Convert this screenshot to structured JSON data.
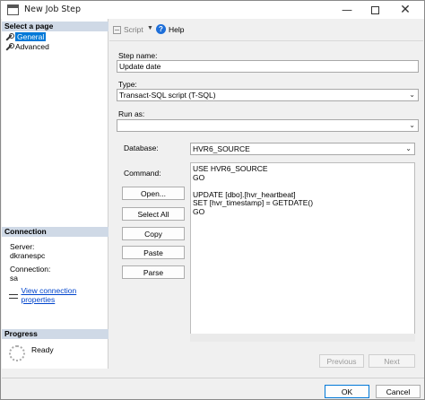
{
  "window": {
    "title": "New Job Step"
  },
  "sidebar": {
    "select_page_header": "Select a page",
    "pages": [
      {
        "label": "General",
        "selected": true
      },
      {
        "label": "Advanced",
        "selected": false
      }
    ],
    "connection_header": "Connection",
    "server_label": "Server:",
    "server_value": "dkranespc",
    "connection_label": "Connection:",
    "connection_value": "sa",
    "view_connection_link": "View connection properties",
    "progress_header": "Progress",
    "progress_status": "Ready"
  },
  "toolbar": {
    "script_label": "Script",
    "help_label": "Help"
  },
  "form": {
    "step_name_label": "Step name:",
    "step_name_value": "Update date",
    "type_label": "Type:",
    "type_value": "Transact-SQL script (T-SQL)",
    "run_as_label": "Run as:",
    "run_as_value": "",
    "database_label": "Database:",
    "database_value": "HVR6_SOURCE",
    "command_label": "Command:",
    "command_text": "USE HVR6_SOURCE\nGO\n\nUPDATE [dbo].[hvr_heartbeat]\nSET [hvr_timestamp] = GETDATE()\nGO"
  },
  "command_buttons": {
    "open": "Open...",
    "select_all": "Select All",
    "copy": "Copy",
    "paste": "Paste",
    "parse": "Parse"
  },
  "nav_buttons": {
    "previous": "Previous",
    "next": "Next"
  },
  "dialog_buttons": {
    "ok": "OK",
    "cancel": "Cancel"
  }
}
